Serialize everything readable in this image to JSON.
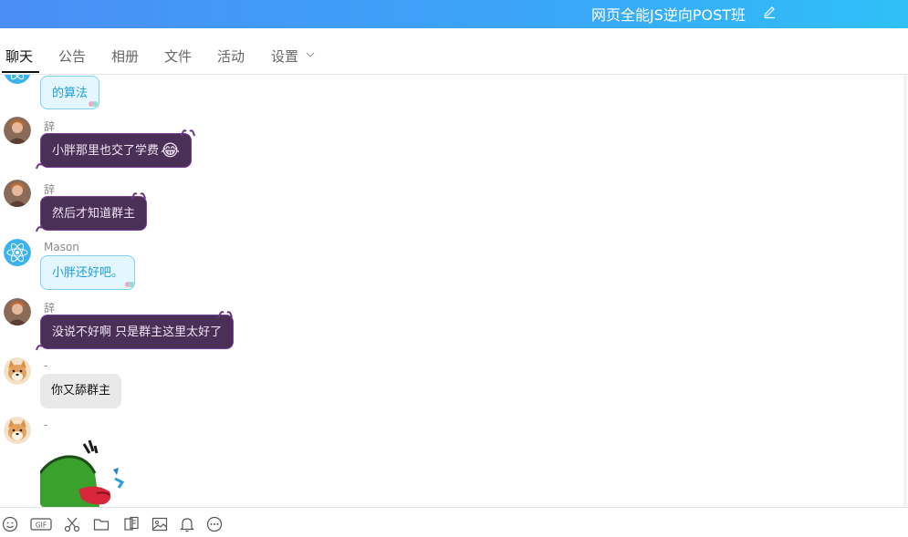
{
  "header": {
    "title": "网页全能JS逆向POST班"
  },
  "tabs": [
    "聊天",
    "公告",
    "相册",
    "文件",
    "活动",
    "设置"
  ],
  "messages": [
    {
      "sender": "",
      "text": "的算法",
      "style": "blue",
      "avatar": "atom-avatar"
    },
    {
      "sender": "辞",
      "text": "小胖那里也交了学费",
      "emoji": "😂",
      "style": "purple",
      "avatar": "user-ci-avatar"
    },
    {
      "sender": "辞",
      "text": "然后才知道群主",
      "style": "purple",
      "avatar": "user-ci-avatar"
    },
    {
      "sender": "Mason",
      "text": "小胖还好吧。",
      "style": "blue",
      "avatar": "atom-avatar"
    },
    {
      "sender": "辞",
      "text": "没说不好啊 只是群主这里太好了",
      "style": "purple",
      "avatar": "user-ci-avatar"
    },
    {
      "sender": "-",
      "text": "你又舔群主",
      "style": "gray",
      "avatar": "shiba-avatar"
    },
    {
      "sender": "-",
      "text": "",
      "style": "sticker",
      "avatar": "shiba-avatar"
    }
  ],
  "toolbar": [
    "smile-icon",
    "gif-icon",
    "scissors-icon",
    "folder-icon",
    "document-icon",
    "image-icon",
    "bell-icon",
    "more-icon"
  ],
  "colors": {
    "titlebar_start": "#4a8ef6",
    "titlebar_end": "#2fc0f7",
    "purple_bubble": "#4a2f57",
    "blue_bubble": "#e4f6ff",
    "gray_bubble": "#e9e9e9"
  }
}
